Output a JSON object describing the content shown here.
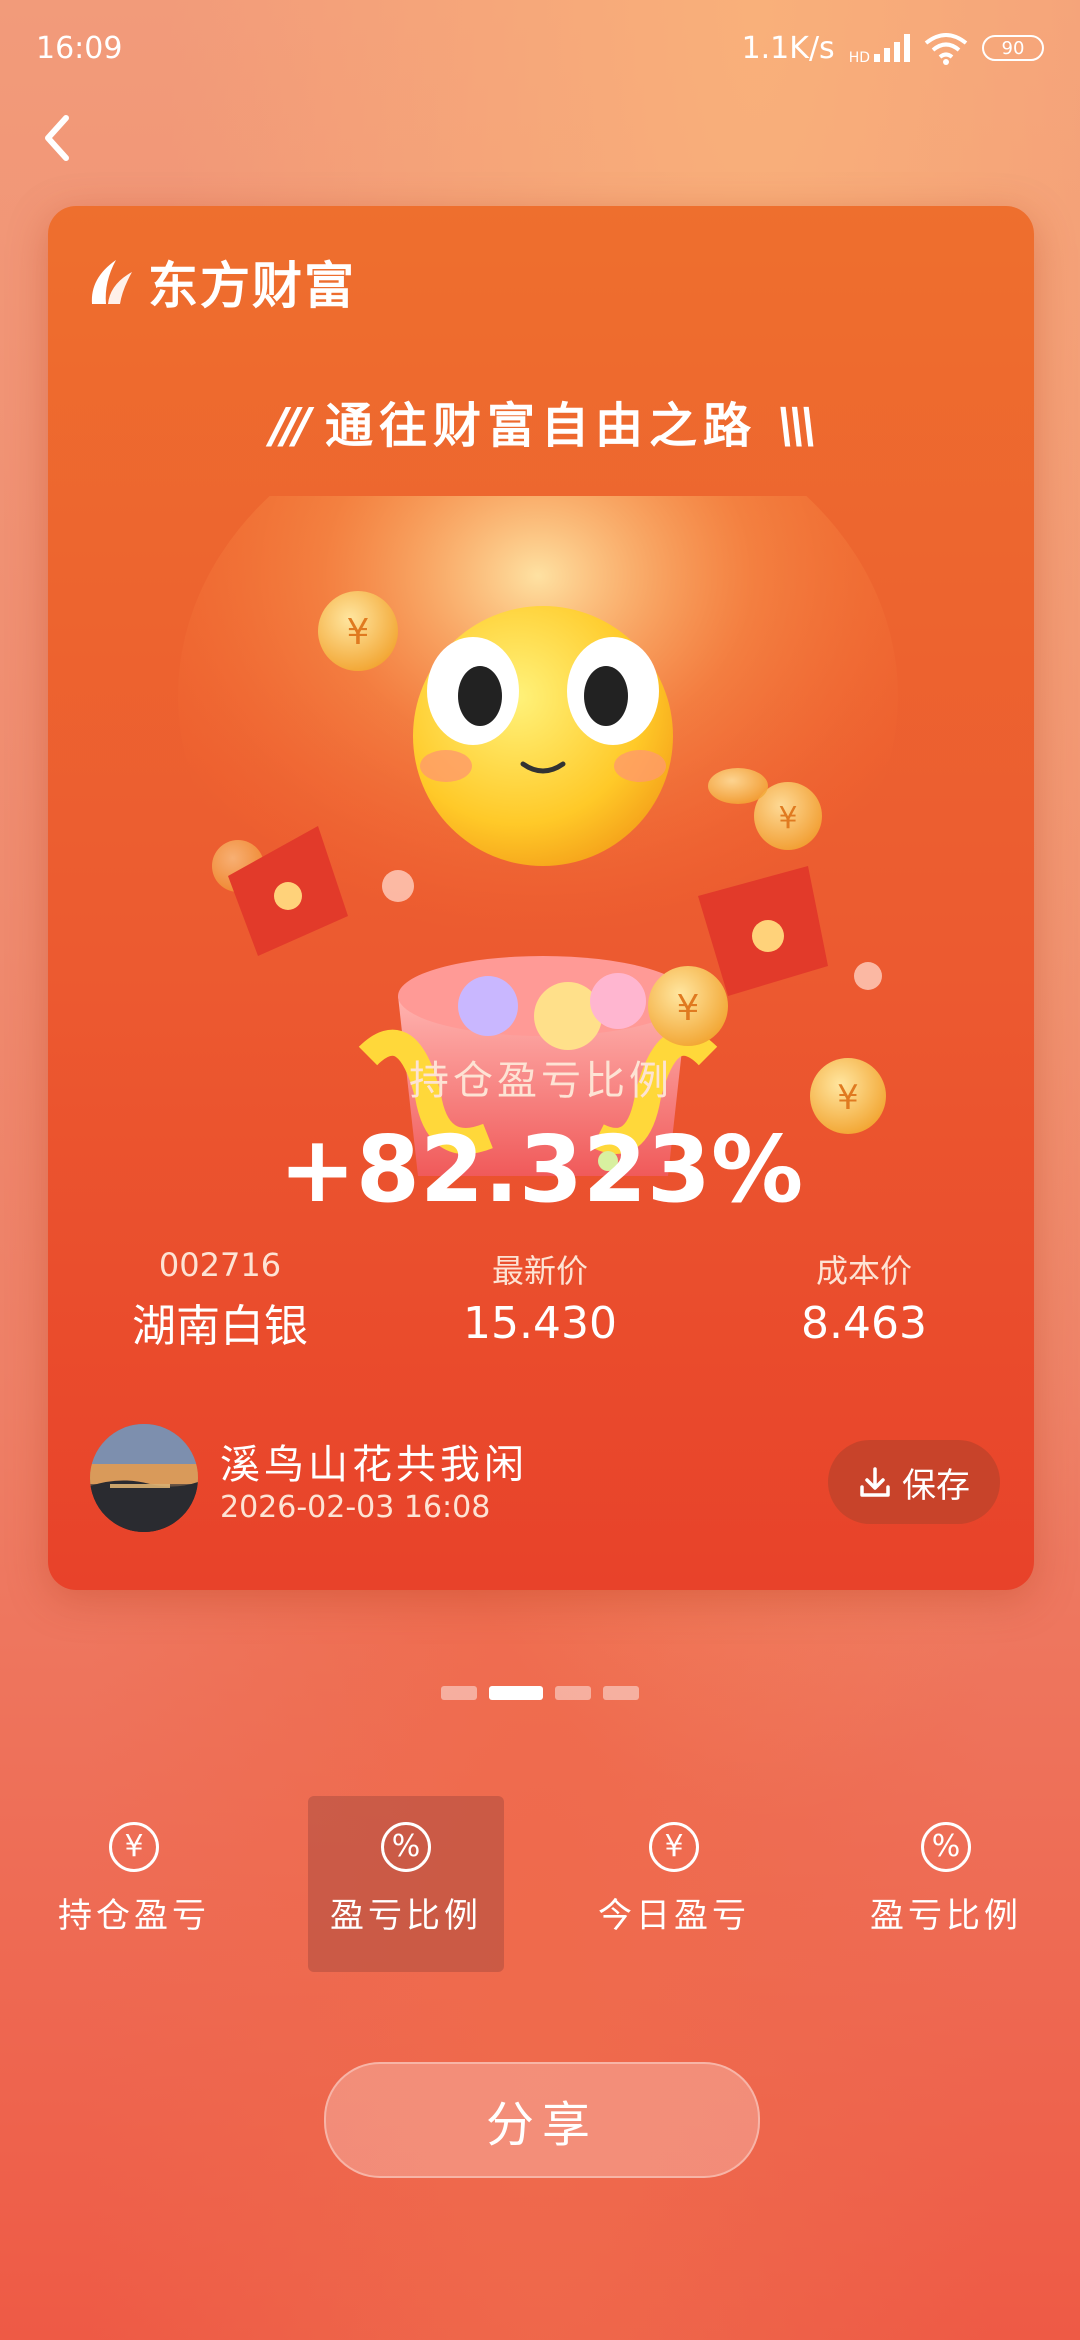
{
  "status_bar": {
    "time": "16:09",
    "net_speed": "1.1K/s",
    "signal_label": "HD",
    "battery": "90"
  },
  "card": {
    "brand": "东方财富",
    "slogan": "通往财富自由之路",
    "ratio_label": "持仓盈亏比例",
    "ratio_value": "+82.323%",
    "stock_code": "002716",
    "stock_name": "湖南白银",
    "latest_price_label": "最新价",
    "latest_price": "15.430",
    "cost_price_label": "成本价",
    "cost_price": "8.463",
    "user_name": "溪鸟山花共我闲",
    "datetime": "2026-02-03 16:08",
    "save_label": "保存"
  },
  "pager": {
    "count": 4,
    "active_index": 1
  },
  "tabs": [
    {
      "label": "持仓盈亏",
      "icon": "yen-icon",
      "symbol": "¥",
      "selected": false
    },
    {
      "label": "盈亏比例",
      "icon": "percent-icon",
      "symbol": "%",
      "selected": true
    },
    {
      "label": "今日盈亏",
      "icon": "yen-icon",
      "symbol": "¥",
      "selected": false
    },
    {
      "label": "盈亏比例",
      "icon": "percent-icon",
      "symbol": "%",
      "selected": false
    }
  ],
  "share_label": "分享",
  "colors": {
    "card_top": "#ee6f2e",
    "card_bottom": "#e8422a",
    "save_button": "#c8432a"
  }
}
